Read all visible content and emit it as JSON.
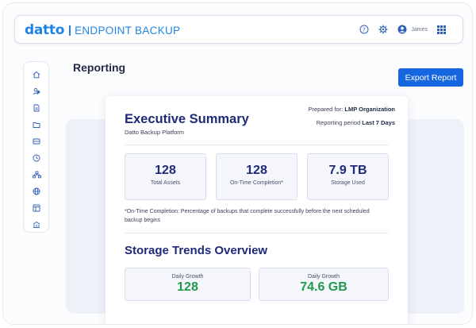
{
  "header": {
    "logo_brand": "datto",
    "logo_product": "ENDPOINT BACKUP",
    "user_name": "James",
    "icons": [
      "help-icon",
      "gear-icon",
      "user-avatar-icon",
      "app-grid-icon"
    ]
  },
  "sidebar": {
    "icons": [
      "home-icon",
      "users-icon",
      "document-icon",
      "folder-icon",
      "server-icon",
      "clock-icon",
      "network-icon",
      "globe-icon",
      "dashboard-icon",
      "building-icon"
    ]
  },
  "page": {
    "title": "Reporting",
    "export_label": "Export Report"
  },
  "report": {
    "title": "Executive Summary",
    "subtitle": "Datto Backup Platform",
    "prepared_label": "Prepared for:",
    "prepared_value": "LMP Organization",
    "period_label": "Reporting period",
    "period_value": "Last 7 Days",
    "stats": [
      {
        "value": "128",
        "label": "Total Assets"
      },
      {
        "value": "128",
        "label": "On-Time Completion*"
      },
      {
        "value": "7.9 TB",
        "label": "Storage Used"
      }
    ],
    "footnote": "*On-Time Completion: Percentage of backups that complete successfully before the next scheduled backup begins",
    "trends_title": "Storage Trends Overview",
    "trends": [
      {
        "label": "Daily Growth",
        "value": "128"
      },
      {
        "label": "Daily Growth",
        "value": "74.6 GB"
      }
    ]
  },
  "colors": {
    "brand_blue": "#1f84e6",
    "primary_button": "#1666e0",
    "heading_navy": "#1f2a78",
    "growth_green": "#1f9a4a"
  }
}
